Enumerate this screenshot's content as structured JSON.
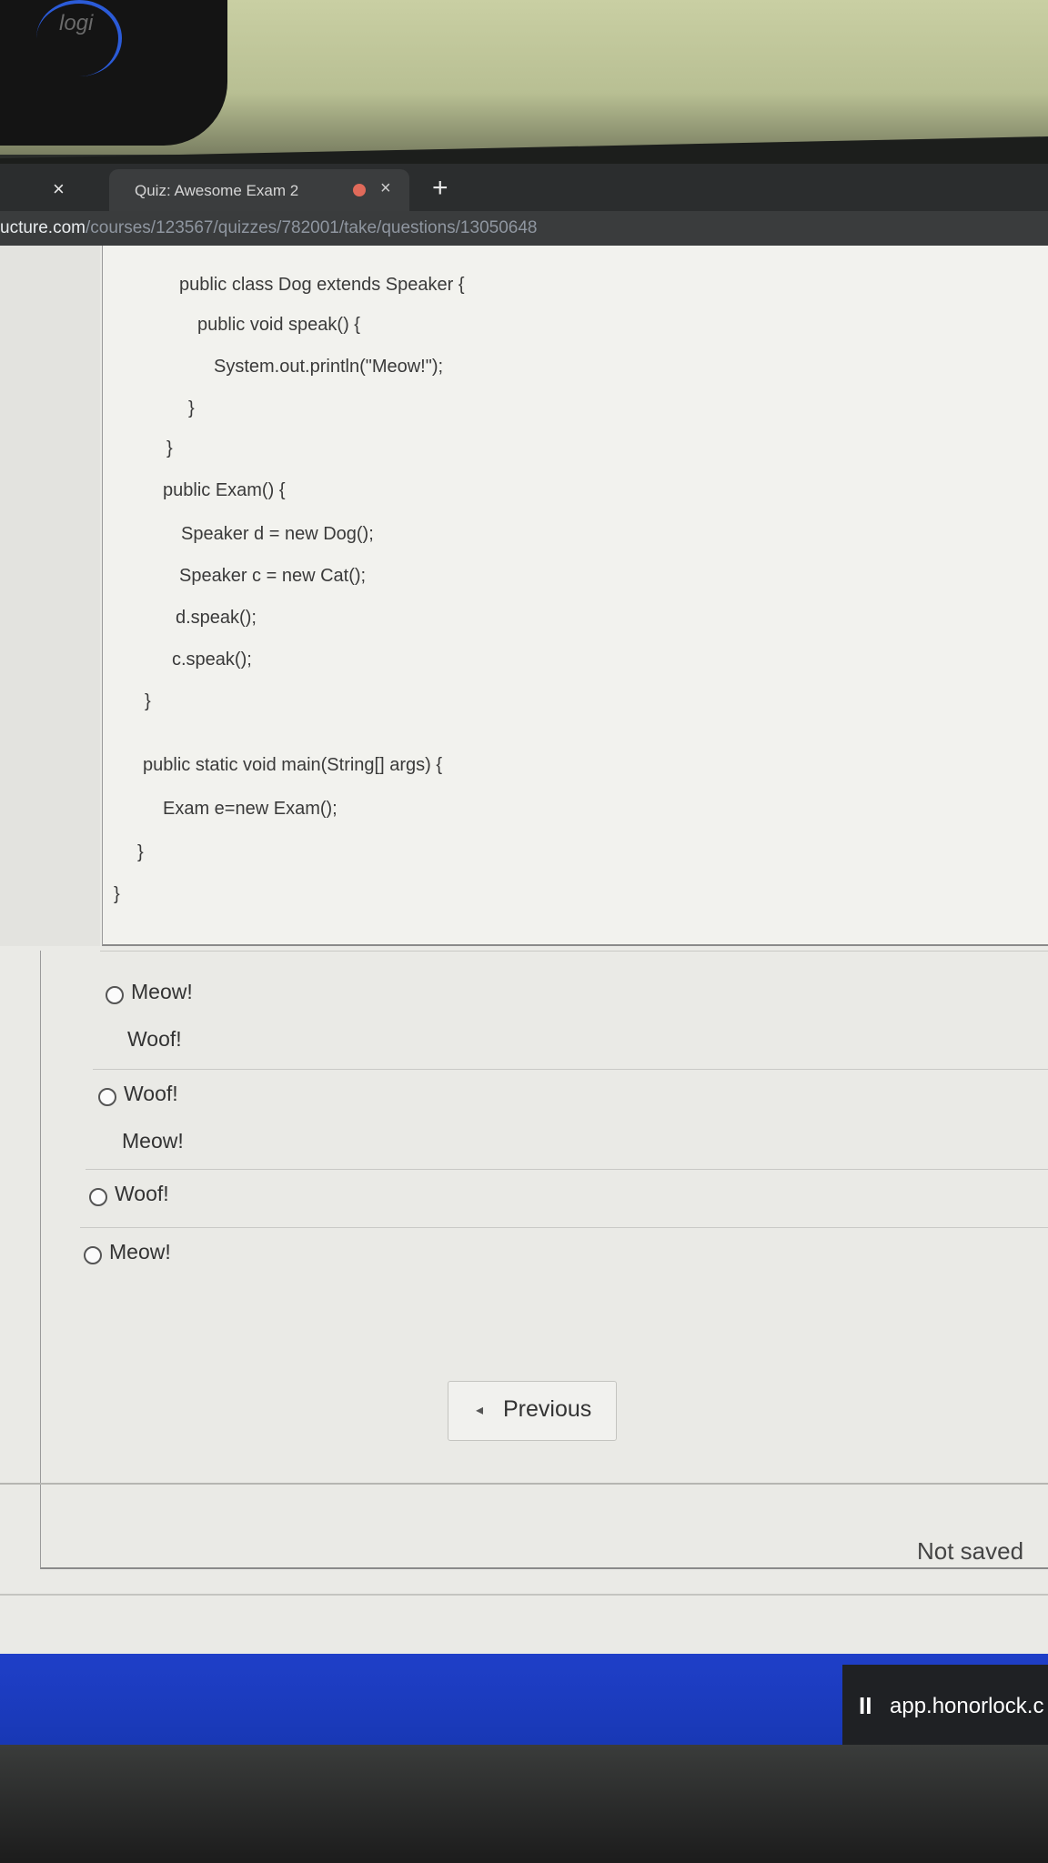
{
  "browser": {
    "tab_title": "Quiz: Awesome Exam 2",
    "tab_close": "×",
    "left_close": "×",
    "new_tab": "+",
    "url_host": "ucture.com",
    "url_path": "/courses/123567/quizzes/782001/take/questions/13050648"
  },
  "webcam": {
    "brand": "logi"
  },
  "code_lines": [
    "public class Dog extends Speaker {",
    "public void speak() {",
    "System.out.println(\"Meow!\");",
    "}",
    "}",
    "public Exam() {",
    "Speaker d = new Dog();",
    "Speaker c = new Cat();",
    "d.speak();",
    "c.speak();",
    "}",
    "public static void main(String[] args) {",
    "Exam e=new Exam();",
    "}",
    "}"
  ],
  "answers": [
    {
      "line1": "Meow!",
      "line2": "Woof!"
    },
    {
      "line1": "Woof!",
      "line2": "Meow!"
    },
    {
      "line1": "Woof!"
    },
    {
      "line1": "Meow!"
    }
  ],
  "nav": {
    "previous_label": "Previous",
    "previous_arrow": "◂"
  },
  "status": {
    "save_state": "Not saved"
  },
  "honorlock": {
    "pause_icon": "II",
    "text": "app.honorlock.c"
  }
}
